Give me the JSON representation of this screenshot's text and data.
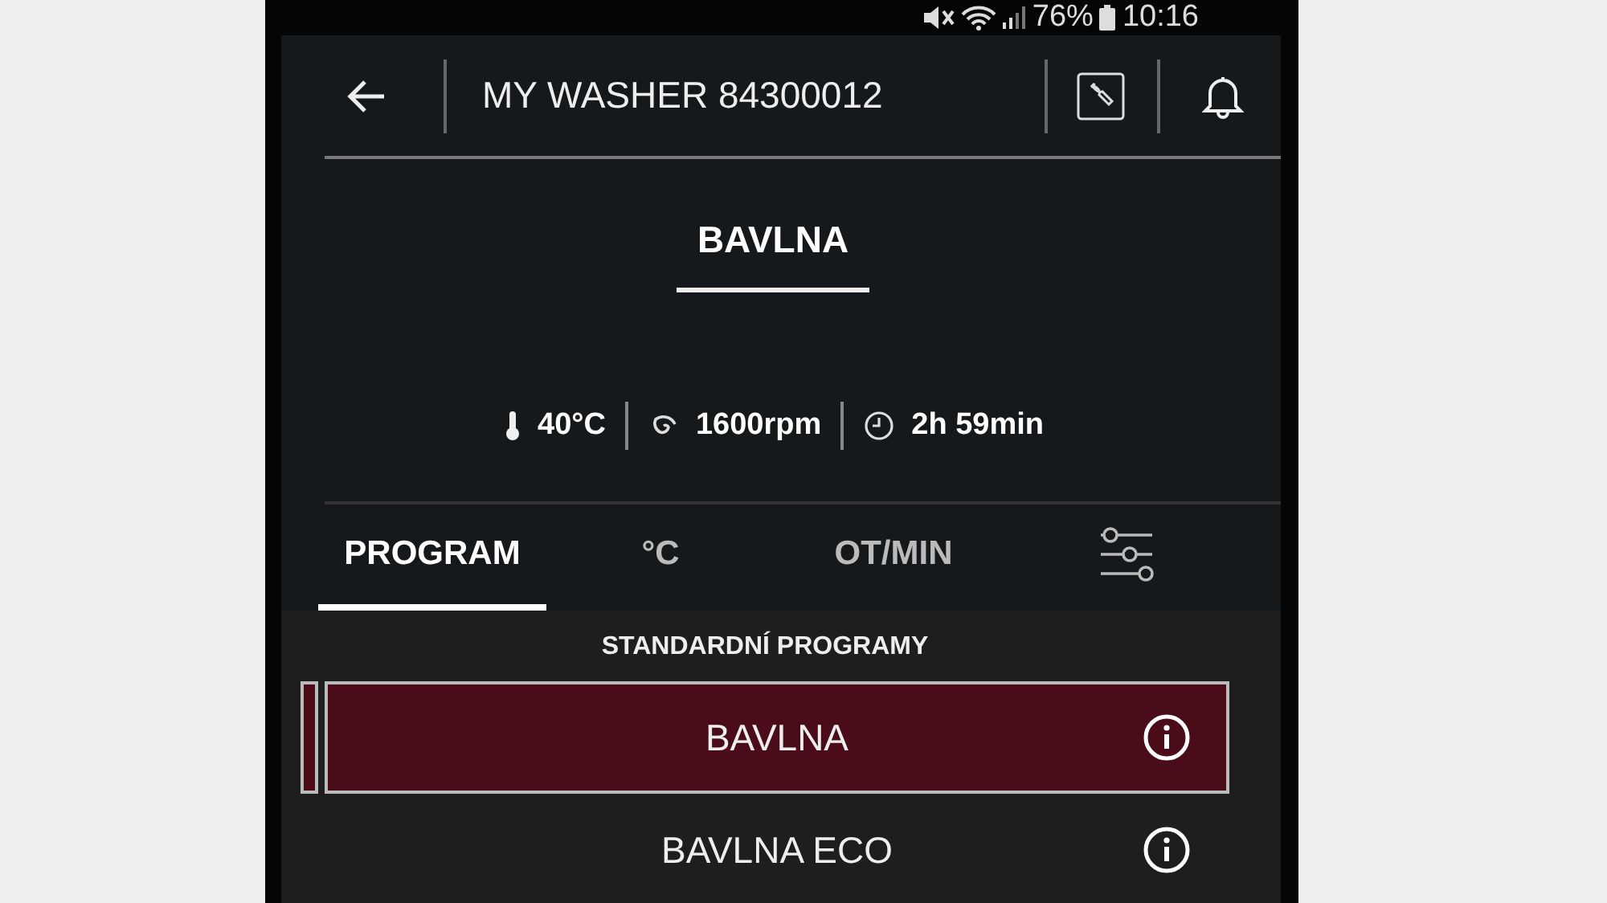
{
  "status_bar": {
    "battery": "76%",
    "time": "10:16"
  },
  "header": {
    "title": "MY WASHER 84300012"
  },
  "program": {
    "name": "BAVLNA",
    "settings": [
      {
        "kind": "temperature",
        "value": "40°C"
      },
      {
        "kind": "spin",
        "value": "1600rpm"
      },
      {
        "kind": "duration",
        "value": "2h 59min"
      }
    ]
  },
  "tabs": [
    {
      "kind": "text",
      "label": "PROGRAM",
      "selected": true
    },
    {
      "kind": "text",
      "label": "°C",
      "selected": false
    },
    {
      "kind": "text",
      "label": "OT/MIN",
      "selected": false
    },
    {
      "kind": "filters",
      "selected": false
    }
  ],
  "list": {
    "heading": "STANDARDNÍ PROGRAMY",
    "items": [
      {
        "label": "BAVLNA",
        "selected": true
      },
      {
        "label": "BAVLNA ECO",
        "selected": false
      }
    ]
  }
}
